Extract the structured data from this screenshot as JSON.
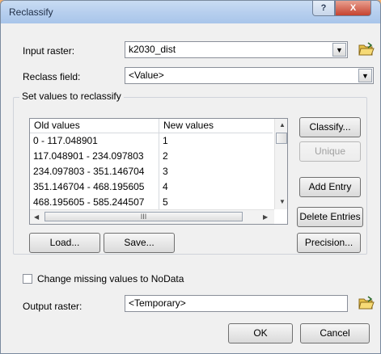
{
  "window": {
    "title": "Reclassify",
    "help_label": "?",
    "close_label": "X"
  },
  "input_raster": {
    "label": "Input raster:",
    "value": "k2030_dist"
  },
  "reclass_field": {
    "label": "Reclass field:",
    "value": "<Value>"
  },
  "group": {
    "title": "Set values to reclassify"
  },
  "table": {
    "headers": [
      "Old values",
      "New values"
    ],
    "rows": [
      {
        "old": "0 - 117.048901",
        "new": "1"
      },
      {
        "old": "117.048901 - 234.097803",
        "new": "2"
      },
      {
        "old": "234.097803 - 351.146704",
        "new": "3"
      },
      {
        "old": "351.146704 - 468.195605",
        "new": "4"
      },
      {
        "old": "468.195605 - 585.244507",
        "new": "5"
      }
    ],
    "scroll_grip": "III"
  },
  "buttons": {
    "classify": "Classify...",
    "unique": "Unique",
    "add_entry": "Add Entry",
    "delete_entries": "Delete Entries",
    "load": "Load...",
    "save": "Save...",
    "precision": "Precision...",
    "ok": "OK",
    "cancel": "Cancel"
  },
  "nodata_checkbox": {
    "label": "Change missing values to NoData",
    "checked": false
  },
  "output_raster": {
    "label": "Output raster:",
    "value": "<Temporary>"
  },
  "icons": [
    "help-icon",
    "close-icon",
    "dropdown-arrow-icon",
    "open-folder-icon",
    "scroll-up-icon",
    "scroll-down-icon",
    "scroll-left-icon",
    "scroll-right-icon"
  ]
}
